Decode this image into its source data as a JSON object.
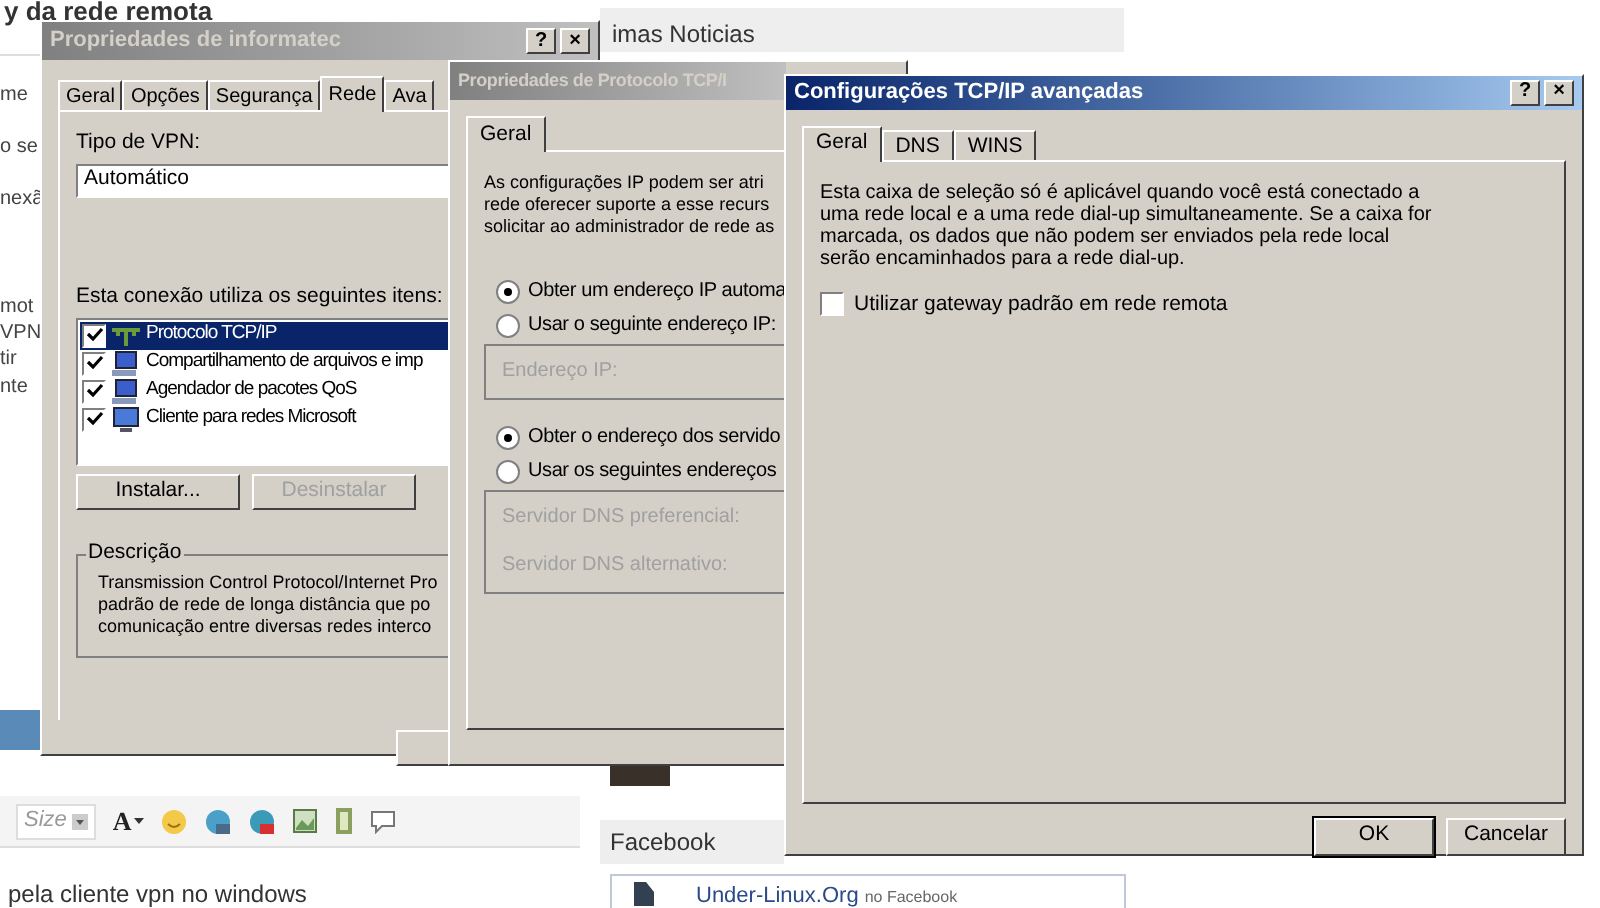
{
  "page": {
    "heading": "y da rede remota",
    "fragments": [
      "me",
      "o se",
      "nexã",
      "mot",
      "VPN",
      "tir",
      "nte"
    ],
    "toolbar": {
      "size": "Size",
      "font_color": "A"
    },
    "editor_text": "pela cliente vpn no windows"
  },
  "sidebar": {
    "news_title": "imas Noticias",
    "facebook_title": "Facebook",
    "facebook_page": "Under-Linux.Org",
    "facebook_suffix": "no Facebook"
  },
  "connection_dialog": {
    "title": "Propriedades de informatec",
    "active": false,
    "title_buttons": [
      "?",
      "×"
    ],
    "tabs": [
      {
        "label": "Geral",
        "selected": false
      },
      {
        "label": "Opções",
        "selected": false
      },
      {
        "label": "Segurança",
        "selected": false
      },
      {
        "label": "Rede",
        "selected": true
      },
      {
        "label": "Ava",
        "selected": false
      }
    ],
    "vpn_type_label": "Tipo de VPN:",
    "vpn_type_value": "Automático",
    "items_label": "Esta conexão utiliza os seguintes itens:",
    "items": [
      {
        "label": "Protocolo TCP/IP",
        "checked": true,
        "selected": true,
        "kind": "protocol"
      },
      {
        "label": "Compartilhamento de arquivos e imp",
        "checked": true,
        "selected": false,
        "kind": "service"
      },
      {
        "label": "Agendador de pacotes QoS",
        "checked": true,
        "selected": false,
        "kind": "service"
      },
      {
        "label": "Cliente para redes Microsoft",
        "checked": true,
        "selected": false,
        "kind": "client"
      }
    ],
    "buttons": [
      {
        "label": "Instalar...",
        "disabled": false
      },
      {
        "label": "Desinstalar",
        "disabled": true
      }
    ],
    "description_title": "Descrição",
    "description": "Transmission Control Protocol/Internet Pro\npadrão de rede de longa distância que po\ncomunicação entre diversas redes interco"
  },
  "protocol_dialog": {
    "title": "Propriedades de Protocolo TCP/I",
    "active": false,
    "tabs": [
      {
        "label": "Geral",
        "selected": true
      }
    ],
    "intro": "As configurações IP podem ser atri\nrede oferecer suporte a esse recurs\nsolicitar ao administrador de rede as",
    "ip_options": [
      {
        "label": "Obter um endereço IP automa",
        "selected": true
      },
      {
        "label": "Usar o seguinte endereço IP:",
        "selected": false
      }
    ],
    "ip_fields": [
      {
        "label": "Endereço IP:",
        "disabled": true
      }
    ],
    "dns_options": [
      {
        "label": "Obter o endereço dos servido",
        "selected": true
      },
      {
        "label": "Usar os seguintes endereços",
        "selected": false
      }
    ],
    "dns_fields": [
      {
        "label": "Servidor DNS preferencial:",
        "disabled": true
      },
      {
        "label": "Servidor DNS alternativo:",
        "disabled": true
      }
    ]
  },
  "advanced_dialog": {
    "title": "Configurações TCP/IP avançadas",
    "active": true,
    "title_buttons": [
      "?",
      "×"
    ],
    "tabs": [
      {
        "label": "Geral",
        "selected": true
      },
      {
        "label": "DNS",
        "selected": false
      },
      {
        "label": "WINS",
        "selected": false
      }
    ],
    "explanation": "Esta caixa de seleção só é aplicável quando você está conectado a\numa rede local e a uma rede dial-up simultaneamente. Se a caixa for\nmarcada, os dados que não podem ser enviados pela rede local\nserão encaminhados para a rede dial-up.",
    "gateway_option": {
      "label": "Utilizar gateway padrão em rede remota",
      "checked": false
    },
    "buttons": [
      {
        "label": "OK",
        "default": true
      },
      {
        "label": "Cancelar",
        "default": false
      }
    ]
  }
}
